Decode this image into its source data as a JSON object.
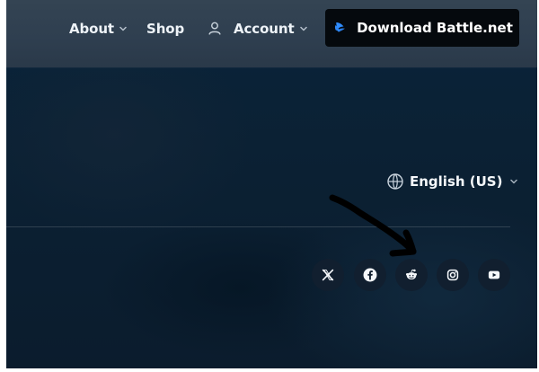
{
  "header": {
    "about_label": "About",
    "shop_label": "Shop",
    "account_label": "Account",
    "download_label": "Download Battle.net",
    "icons": {
      "about_chevron": "chevron-down-icon",
      "account_icon": "user-icon",
      "account_chevron": "chevron-down-icon",
      "download_icon": "battle-net-icon"
    }
  },
  "footer": {
    "language": {
      "label": "English (US)",
      "icon": "globe-icon",
      "chevron": "chevron-down-icon"
    },
    "social": [
      {
        "name": "X",
        "icon": "x-icon"
      },
      {
        "name": "Facebook",
        "icon": "facebook-icon"
      },
      {
        "name": "Reddit",
        "icon": "reddit-icon"
      },
      {
        "name": "Instagram",
        "icon": "instagram-icon"
      },
      {
        "name": "YouTube",
        "icon": "youtube-icon"
      }
    ]
  },
  "overlay": {
    "icon": "hand-drawn-arrow-icon"
  },
  "colors": {
    "header_background": "#2f3f50",
    "page_background": "#0b2134",
    "download_button": "#05090d",
    "social_button": "#111f2f",
    "text": "#ffffff",
    "accent_blue": "#2f8cff",
    "annotation": "#000000"
  }
}
